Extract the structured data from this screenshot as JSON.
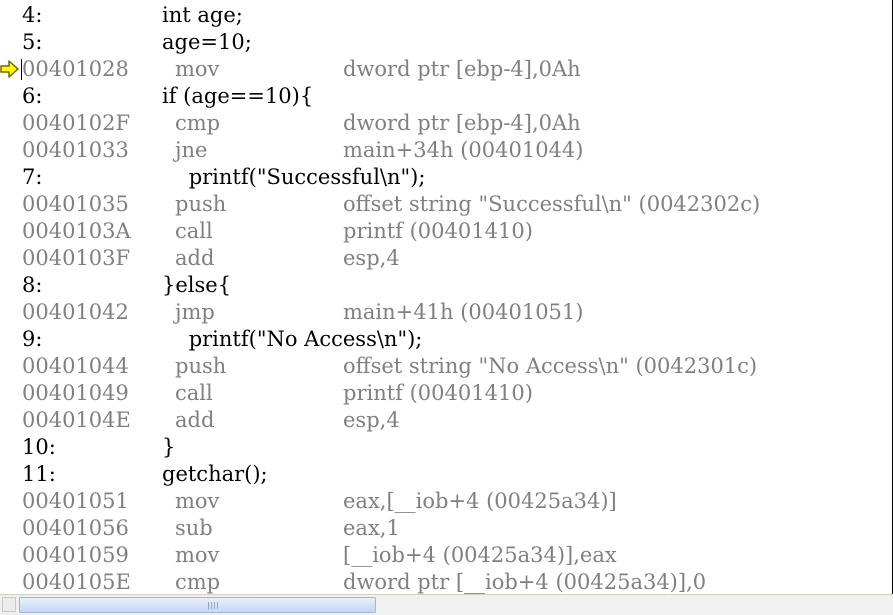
{
  "lines": [
    {
      "kind": "src",
      "num": "4:",
      "code": "int age;"
    },
    {
      "kind": "src",
      "num": "5:",
      "code": "age=10;"
    },
    {
      "kind": "asm",
      "addr": "00401028",
      "mn": "mov",
      "op": "dword ptr [ebp-4],0Ah"
    },
    {
      "kind": "src",
      "num": "6:",
      "code": "if (age==10){"
    },
    {
      "kind": "asm",
      "addr": "0040102F",
      "mn": "cmp",
      "op": "dword ptr [ebp-4],0Ah"
    },
    {
      "kind": "asm",
      "addr": "00401033",
      "mn": "jne",
      "op": "main+34h (00401044)"
    },
    {
      "kind": "src",
      "num": "7:",
      "code": "    printf(\"Successful\\n\");"
    },
    {
      "kind": "asm",
      "addr": "00401035",
      "mn": "push",
      "op": "offset string \"Successful\\n\" (0042302c)"
    },
    {
      "kind": "asm",
      "addr": "0040103A",
      "mn": "call",
      "op": "printf (00401410)"
    },
    {
      "kind": "asm",
      "addr": "0040103F",
      "mn": "add",
      "op": "esp,4"
    },
    {
      "kind": "src",
      "num": "8:",
      "code": "}else{"
    },
    {
      "kind": "asm",
      "addr": "00401042",
      "mn": "jmp",
      "op": "main+41h (00401051)"
    },
    {
      "kind": "src",
      "num": "9:",
      "code": "    printf(\"No Access\\n\");"
    },
    {
      "kind": "asm",
      "addr": "00401044",
      "mn": "push",
      "op": "offset string \"No Access\\n\" (0042301c)"
    },
    {
      "kind": "asm",
      "addr": "00401049",
      "mn": "call",
      "op": "printf (00401410)"
    },
    {
      "kind": "asm",
      "addr": "0040104E",
      "mn": "add",
      "op": "esp,4"
    },
    {
      "kind": "src",
      "num": "10:",
      "code": "}"
    },
    {
      "kind": "src",
      "num": "11:",
      "code": "getchar();"
    },
    {
      "kind": "asm",
      "addr": "00401051",
      "mn": "mov",
      "op": "eax,[__iob+4 (00425a34)]"
    },
    {
      "kind": "asm",
      "addr": "00401056",
      "mn": "sub",
      "op": "eax,1"
    },
    {
      "kind": "asm",
      "addr": "00401059",
      "mn": "mov",
      "op": "[__iob+4 (00425a34)],eax"
    },
    {
      "kind": "asm",
      "addr": "0040105E",
      "mn": "cmp",
      "op": "dword ptr [__iob+4 (00425a34)],0"
    }
  ],
  "current_instruction_icon": "arrow-right-icon",
  "colors": {
    "source_text": "#000000",
    "asm_text": "#808080",
    "marker_fill": "#ffff00",
    "marker_stroke": "#806000"
  }
}
